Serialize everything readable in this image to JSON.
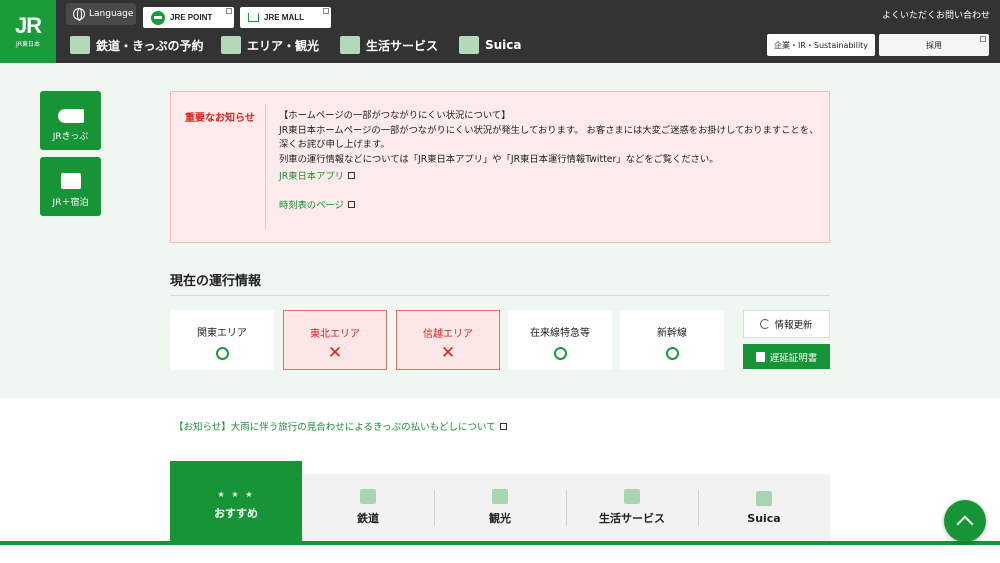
{
  "header": {
    "logo_mark": "JR",
    "logo_sub": "JR東日本",
    "language_label": "Language",
    "jre_point": "JRE POINT",
    "jre_mall": "JRE MALL",
    "faq_contact": "よくいただくお問い合わせ",
    "corp_link": "企業・IR・Sustainability",
    "recruit_link": "採用",
    "nav": [
      {
        "label": "鉄道・きっぷの予約",
        "icon": "train-icon"
      },
      {
        "label": "エリア・観光",
        "icon": "suitcase-icon"
      },
      {
        "label": "生活サービス",
        "icon": "shopping-bag-icon"
      },
      {
        "label": "Suica",
        "icon": "card-icon"
      }
    ]
  },
  "side": {
    "jr_ticket": "JRきっぷ",
    "jr_stay": "JR＋宿泊"
  },
  "notice": {
    "label": "重要なお知らせ",
    "title": "【ホームページの一部がつながりにくい状況について】",
    "body": "JR東日本ホームページの一部がつながりにくい状況が発生しております。 お客さまには大変ご迷惑をお掛けしておりますことを、深くお詫び申し上げます。",
    "body2": "列車の運行情報などについては「JR東日本アプリ」や「JR東日本運行情報Twitter」などをご覧ください。",
    "app_link": "JR東日本アプリ",
    "timetable_link": "時刻表のページ"
  },
  "operation": {
    "title": "現在の運行情報",
    "areas": [
      {
        "name": "関東エリア",
        "status": "normal"
      },
      {
        "name": "東北エリア",
        "status": "alert"
      },
      {
        "name": "信越エリア",
        "status": "alert"
      },
      {
        "name": "在来線特急等",
        "status": "normal"
      },
      {
        "name": "新幹線",
        "status": "normal"
      }
    ],
    "refresh_label": "情報更新",
    "delay_cert_label": "遅延証明書"
  },
  "info_link": "【お知らせ】大雨に伴う旅行の見合わせによるきっぷの払いもどしについて",
  "tabs": [
    {
      "label": "おすすめ",
      "active": true
    },
    {
      "label": "鉄道",
      "active": false
    },
    {
      "label": "観光",
      "active": false
    },
    {
      "label": "生活サービス",
      "active": false
    },
    {
      "label": "Suica",
      "active": false
    }
  ],
  "colors": {
    "brand_green": "#179436",
    "alert_red": "#d6241b",
    "header_bg": "#333333"
  }
}
